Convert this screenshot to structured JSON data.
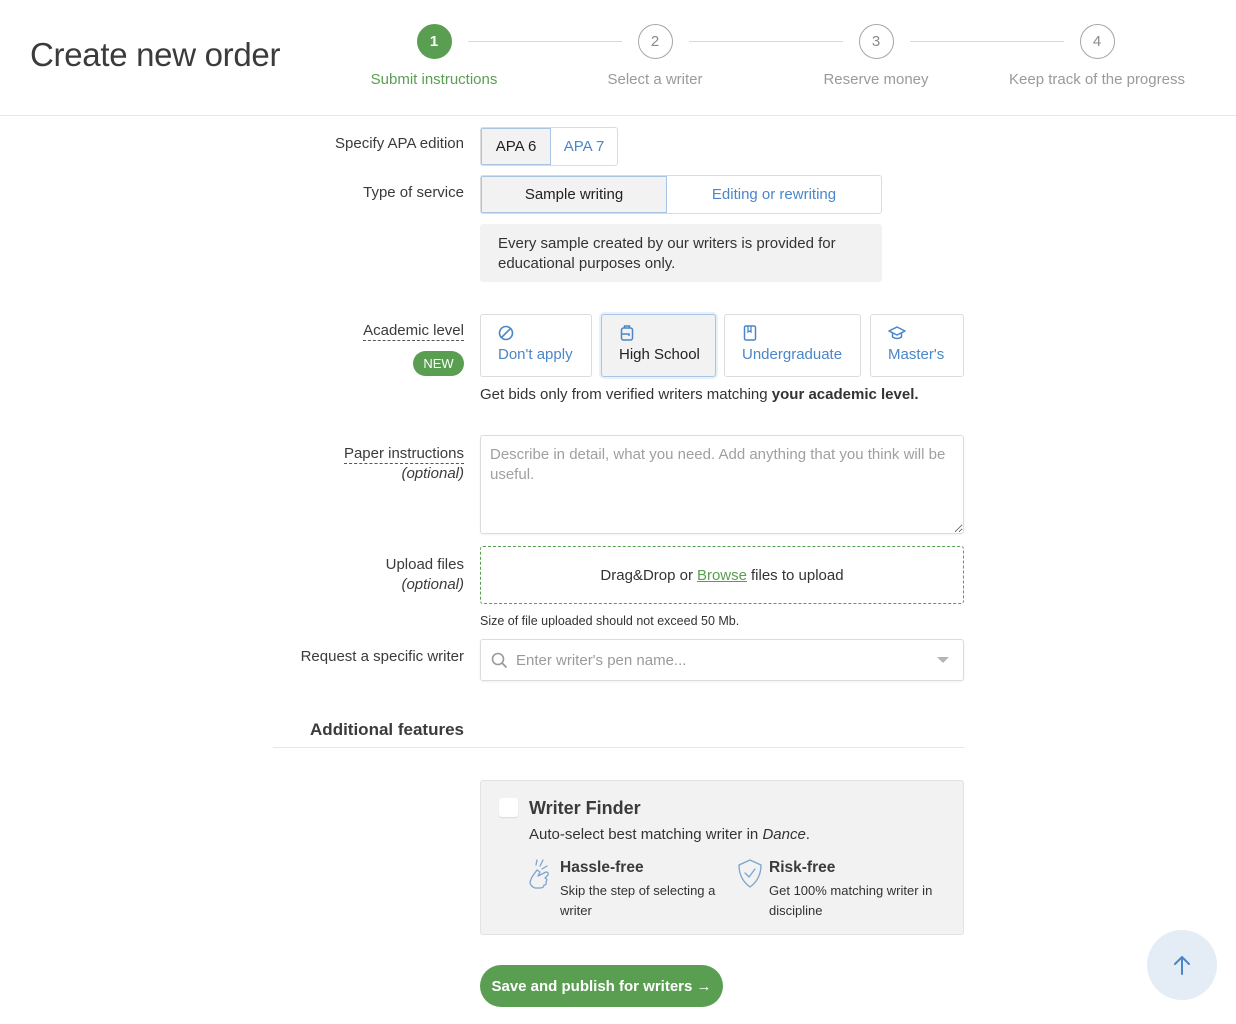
{
  "header": {
    "title": "Create new order",
    "steps": [
      {
        "number": "1",
        "label": "Submit instructions",
        "active": true
      },
      {
        "number": "2",
        "label": "Select a writer",
        "active": false
      },
      {
        "number": "3",
        "label": "Reserve money",
        "active": false
      },
      {
        "number": "4",
        "label": "Keep track of the progress",
        "active": false
      }
    ]
  },
  "apa": {
    "label": "Specify APA edition",
    "options": [
      "APA 6",
      "APA 7"
    ],
    "selected": "APA 6"
  },
  "service": {
    "label": "Type of service",
    "options": [
      "Sample writing",
      "Editing or rewriting"
    ],
    "selected": "Sample writing",
    "notice": "Every sample created by our writers is provided for educational purposes only."
  },
  "academic_level": {
    "label": "Academic level",
    "badge": "NEW",
    "options": [
      {
        "label": "Don't apply",
        "icon": "prohibited-icon"
      },
      {
        "label": "High School",
        "icon": "backpack-icon"
      },
      {
        "label": "Undergraduate",
        "icon": "book-icon"
      },
      {
        "label": "Master's",
        "icon": "graduation-cap-icon"
      }
    ],
    "selected": "High School",
    "hint_prefix": "Get bids only from verified writers matching ",
    "hint_bold": "your academic level."
  },
  "instructions": {
    "label": "Paper instructions",
    "sublabel": "(optional)",
    "placeholder": "Describe in detail, what you need. Add anything that you think will be useful.",
    "value": ""
  },
  "upload": {
    "label": "Upload files",
    "sublabel": "(optional)",
    "text_before": "Drag&Drop or",
    "link": "Browse",
    "text_after": "files to upload",
    "size_hint": "Size of file uploaded should not exceed 50 Mb."
  },
  "writer": {
    "label": "Request a specific writer",
    "placeholder": "Enter writer's pen name...",
    "value": ""
  },
  "additional": {
    "title": "Additional features",
    "finder": {
      "title": "Writer Finder",
      "checked": false,
      "desc_prefix": "Auto-select best matching writer in ",
      "desc_subject": "Dance",
      "desc_suffix": ".",
      "features": [
        {
          "title": "Hassle-free",
          "desc": "Skip the step of selecting a writer",
          "icon": "snap-fingers-icon"
        },
        {
          "title": "Risk-free",
          "desc": "Get 100% matching writer in discipline",
          "icon": "shield-check-icon"
        }
      ]
    }
  },
  "submit_label": "Save and publish for writers →",
  "colors": {
    "accent_green": "#5a9e52",
    "link_blue": "#4a86c8",
    "scroll_button_bg": "#e4ecf6"
  }
}
